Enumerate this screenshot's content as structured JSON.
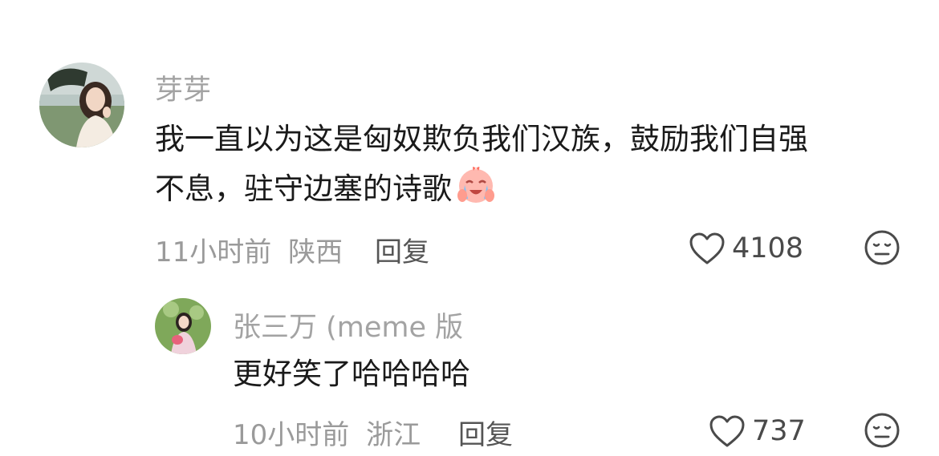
{
  "comments": [
    {
      "user": "芽芽",
      "text_line1": "我一直以为这是匈奴欺负我们汉族，鼓励我们自强",
      "text_line2": "不息，驻守边塞的诗歌",
      "emoji": "crying-laughing-emoji",
      "time": "11小时前",
      "location": "陕西",
      "reply_label": "回复",
      "likes": "4108"
    },
    {
      "user": "张三万 (meme 版",
      "text": "更好笑了哈哈哈哈",
      "time": "10小时前",
      "location": "浙江",
      "reply_label": "回复",
      "likes": "737"
    }
  ],
  "colors": {
    "username": "#a3a3a3",
    "text": "#1a1a1a",
    "meta": "#9a9a9a",
    "reply": "#555555",
    "icon": "#4a4a4a"
  },
  "icons": {
    "like": "heart-outline-icon",
    "dislike": "neutral-face-icon"
  }
}
